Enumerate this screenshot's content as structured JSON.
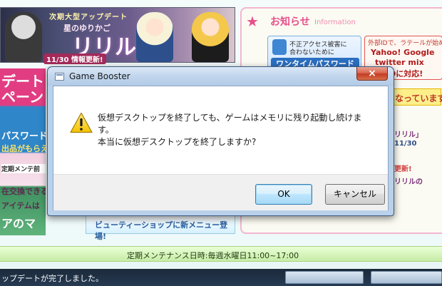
{
  "background": {
    "banner_tag": "次期大型アップデート",
    "banner_subtitle": "星のゆりかご",
    "banner_title": "リリル",
    "banner_date": "11/30 情報更新!",
    "left_strip": {
      "line1": "デート",
      "line2": "ペーン",
      "line3": "パスワード",
      "line4": "出品がもらえ",
      "line5": "定期メンテ前",
      "line6": "在交換できる",
      "line7": "アイテムは",
      "line8": "アのマ"
    },
    "bottom_banner": "ビューティーショップに新メニュー登場!",
    "info_panel": {
      "title": "お知らせ",
      "title_en": "Information",
      "card1_line1": "不正アクセス被害に",
      "card1_line2": "合わないために",
      "card1_button": "ワンタイムパスワード",
      "card2_line0": "外部IDで、ラテールが始められ",
      "card2_line1": "Yahoo! Google",
      "card2_line2": "twitter mix",
      "card2_line3": "IDに対応!",
      "hot_label": "なっています",
      "line1": "リリル」",
      "line2": "11/30",
      "line3": "更新!",
      "line4": "リリルの"
    },
    "maintenance_text": "定期メンテナンス日時:毎週水曜日11:00~17:00",
    "status_text": "ップデートが完了しました。"
  },
  "dialog": {
    "title": "Game Booster",
    "close_symbol": "×",
    "message_line1": "仮想デスクトップを終了しても、ゲームはメモリに残り起動し続けま",
    "message_line2": "す。",
    "message_line3": "本当に仮想デスクトップを終了しますか?",
    "ok_label": "OK",
    "cancel_label": "キャンセル",
    "icon": "warning-icon"
  },
  "colors": {
    "dialog_frame": "#b9d1ea",
    "close_button": "#c43c22",
    "ok_button_border": "#3c7fb1",
    "warning_yellow": "#f5c400",
    "maintenance_bar": "#c7eca6",
    "info_pink": "#e7508a"
  }
}
